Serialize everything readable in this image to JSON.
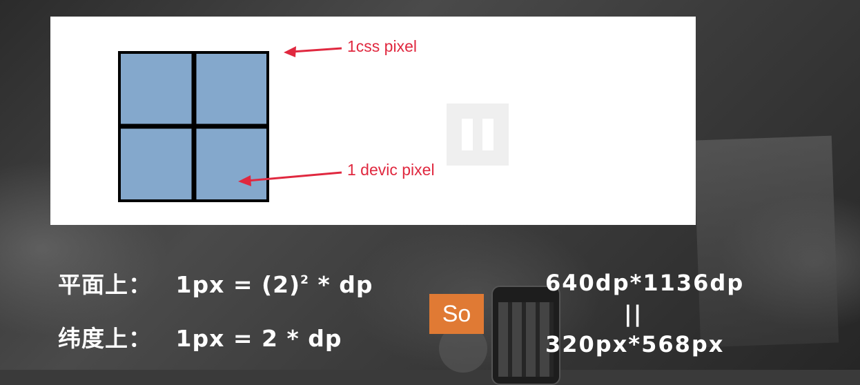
{
  "slide": {
    "annotations": {
      "css_pixel": "1css pixel",
      "device_pixel": "1 devic pixel"
    },
    "grid": {
      "rows": 2,
      "cols": 2,
      "fill": "#84a8cc",
      "line": "#000000"
    },
    "annotation_color": "#e0283f"
  },
  "player": {
    "pause_icon": "pause-icon"
  },
  "formulas": {
    "line1": {
      "label": "平面上：",
      "expr": "1px = (2)",
      "exp": "2",
      "tail": " * dp"
    },
    "line2": {
      "label": "纬度上：",
      "expr": "1px = 2 * dp"
    }
  },
  "so_badge": {
    "text": "So",
    "color": "#e07a34"
  },
  "resolution": {
    "dp": "640dp*1136dp",
    "equals": "||",
    "px": "320px*568px"
  }
}
